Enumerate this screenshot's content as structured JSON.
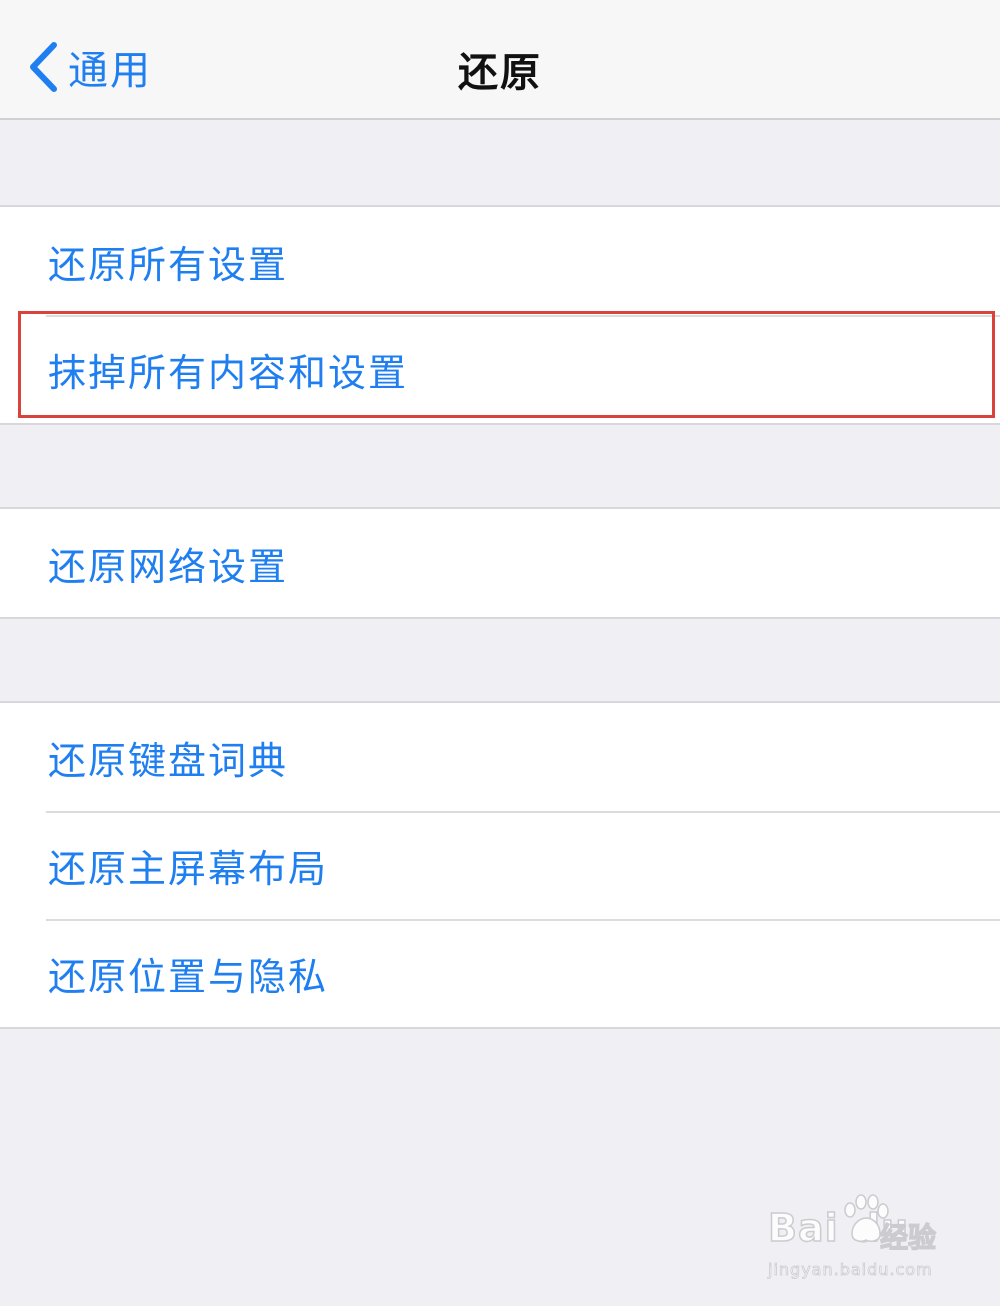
{
  "navbar": {
    "back_label": "通用",
    "title": "还原"
  },
  "groups": [
    {
      "rows": [
        {
          "label": "还原所有设置"
        },
        {
          "label": "抹掉所有内容和设置",
          "highlighted": true
        }
      ]
    },
    {
      "rows": [
        {
          "label": "还原网络设置"
        }
      ]
    },
    {
      "rows": [
        {
          "label": "还原键盘词典"
        },
        {
          "label": "还原主屏幕布局"
        },
        {
          "label": "还原位置与隐私"
        }
      ]
    }
  ],
  "watermark": {
    "brand": "Bai du",
    "brand_cn": "经验",
    "url": "jingyan.baidu.com"
  },
  "colors": {
    "accent": "#1f7ff0",
    "highlight": "#d9433b",
    "background": "#efeff4"
  },
  "icons": {
    "back": "chevron-left-icon",
    "watermark": "paw-icon"
  }
}
